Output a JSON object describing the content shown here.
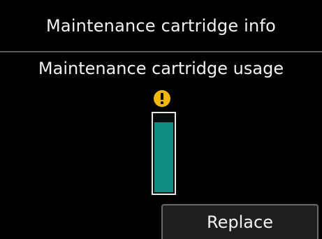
{
  "header": {
    "title": "Maintenance cartridge info"
  },
  "main": {
    "usage_title": "Maintenance cartridge usage",
    "warning_icon": "exclamation-warning-icon",
    "usage_level": 0.9
  },
  "actions": {
    "replace_label": "Replace"
  },
  "colors": {
    "background": "#000000",
    "gauge_fill": "#0f8d83",
    "warning": "#f2b705"
  }
}
